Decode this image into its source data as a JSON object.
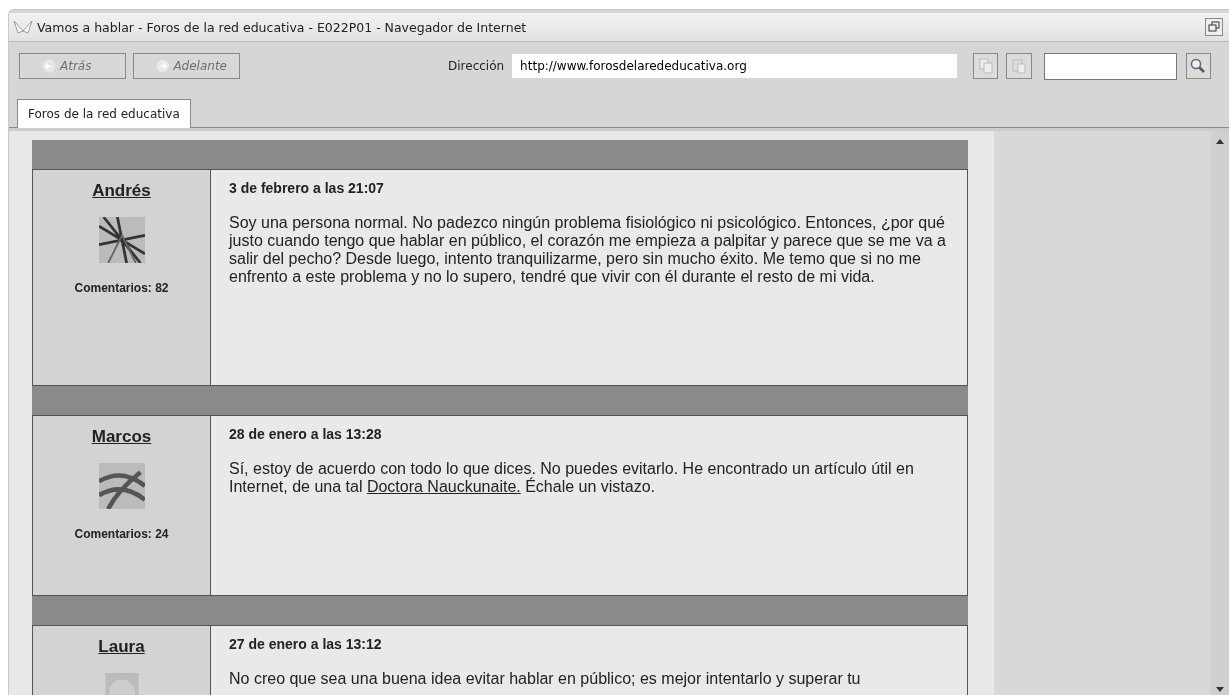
{
  "window": {
    "title": "Vamos a hablar - Foros de la red educativa - E022P01 - Navegador de Internet"
  },
  "toolbar": {
    "buttons": [
      {
        "label": "Atrás",
        "kind": "back",
        "disabled": true
      },
      {
        "label": "Adelante",
        "kind": "forward",
        "disabled": true
      }
    ],
    "address_label": "Dirección",
    "address": "http://www.forosdelarededucativa.org"
  },
  "tabs": [
    {
      "label": "Foros de la red educativa",
      "selected": true
    }
  ],
  "posts": [
    {
      "author": "Andrés",
      "comments": "Comentarios: 82",
      "date": "3 de febrero a las 21:07",
      "body": [
        {
          "kind": "text",
          "text": "Soy una persona normal. No padezco ningún problema fisiológico ni psicológico. Entonces, ¿por qué justo cuando tengo que hablar en público, el corazón me empieza a palpitar y parece que se me va a salir del pecho? Desde luego, intento tranquilizarme, pero sin mucho éxito. Me temo que si no me enfrento a este problema y no lo supero, tendré que vivir con él durante el resto de mi vida."
        }
      ]
    },
    {
      "author": "Marcos",
      "comments": "Comentarios: 24",
      "date": "28 de enero a las 13:28",
      "body": [
        {
          "kind": "text",
          "text": "Sí, estoy de acuerdo con todo lo que dices. No puedes evitarlo. He encontrado un artículo útil en Internet, de una tal "
        },
        {
          "kind": "link",
          "text": "Doctora Nauckunaite."
        },
        {
          "kind": "text",
          "text": " Échale un vistazo."
        }
      ]
    },
    {
      "author": "Laura",
      "date": "27 de enero a las 13:12",
      "body": [
        {
          "kind": "text",
          "text": "No creo que sea una buena idea evitar hablar en público; es mejor intentarlo y superar tu"
        }
      ]
    }
  ]
}
